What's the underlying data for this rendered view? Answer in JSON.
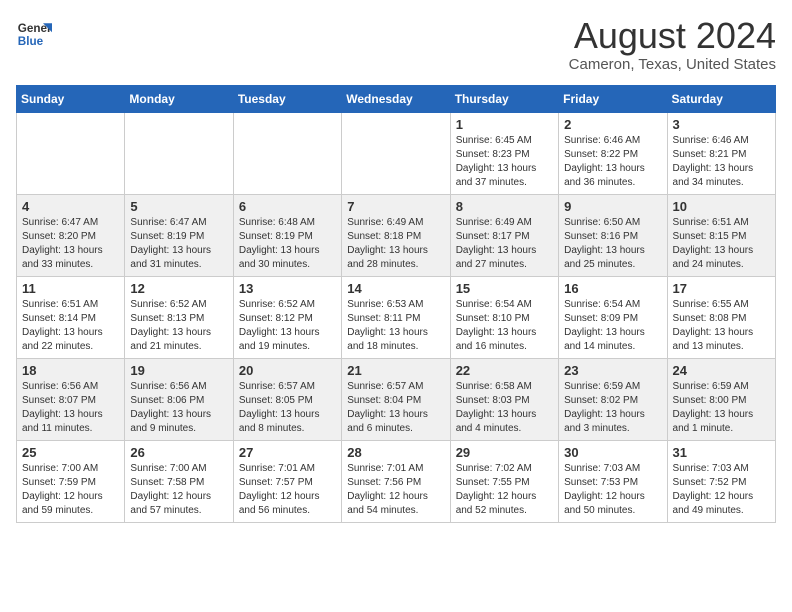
{
  "logo": {
    "line1": "General",
    "line2": "Blue"
  },
  "title": "August 2024",
  "subtitle": "Cameron, Texas, United States",
  "days_of_week": [
    "Sunday",
    "Monday",
    "Tuesday",
    "Wednesday",
    "Thursday",
    "Friday",
    "Saturday"
  ],
  "weeks": [
    [
      {
        "day": "",
        "info": ""
      },
      {
        "day": "",
        "info": ""
      },
      {
        "day": "",
        "info": ""
      },
      {
        "day": "",
        "info": ""
      },
      {
        "day": "1",
        "info": "Sunrise: 6:45 AM\nSunset: 8:23 PM\nDaylight: 13 hours\nand 37 minutes."
      },
      {
        "day": "2",
        "info": "Sunrise: 6:46 AM\nSunset: 8:22 PM\nDaylight: 13 hours\nand 36 minutes."
      },
      {
        "day": "3",
        "info": "Sunrise: 6:46 AM\nSunset: 8:21 PM\nDaylight: 13 hours\nand 34 minutes."
      }
    ],
    [
      {
        "day": "4",
        "info": "Sunrise: 6:47 AM\nSunset: 8:20 PM\nDaylight: 13 hours\nand 33 minutes."
      },
      {
        "day": "5",
        "info": "Sunrise: 6:47 AM\nSunset: 8:19 PM\nDaylight: 13 hours\nand 31 minutes."
      },
      {
        "day": "6",
        "info": "Sunrise: 6:48 AM\nSunset: 8:19 PM\nDaylight: 13 hours\nand 30 minutes."
      },
      {
        "day": "7",
        "info": "Sunrise: 6:49 AM\nSunset: 8:18 PM\nDaylight: 13 hours\nand 28 minutes."
      },
      {
        "day": "8",
        "info": "Sunrise: 6:49 AM\nSunset: 8:17 PM\nDaylight: 13 hours\nand 27 minutes."
      },
      {
        "day": "9",
        "info": "Sunrise: 6:50 AM\nSunset: 8:16 PM\nDaylight: 13 hours\nand 25 minutes."
      },
      {
        "day": "10",
        "info": "Sunrise: 6:51 AM\nSunset: 8:15 PM\nDaylight: 13 hours\nand 24 minutes."
      }
    ],
    [
      {
        "day": "11",
        "info": "Sunrise: 6:51 AM\nSunset: 8:14 PM\nDaylight: 13 hours\nand 22 minutes."
      },
      {
        "day": "12",
        "info": "Sunrise: 6:52 AM\nSunset: 8:13 PM\nDaylight: 13 hours\nand 21 minutes."
      },
      {
        "day": "13",
        "info": "Sunrise: 6:52 AM\nSunset: 8:12 PM\nDaylight: 13 hours\nand 19 minutes."
      },
      {
        "day": "14",
        "info": "Sunrise: 6:53 AM\nSunset: 8:11 PM\nDaylight: 13 hours\nand 18 minutes."
      },
      {
        "day": "15",
        "info": "Sunrise: 6:54 AM\nSunset: 8:10 PM\nDaylight: 13 hours\nand 16 minutes."
      },
      {
        "day": "16",
        "info": "Sunrise: 6:54 AM\nSunset: 8:09 PM\nDaylight: 13 hours\nand 14 minutes."
      },
      {
        "day": "17",
        "info": "Sunrise: 6:55 AM\nSunset: 8:08 PM\nDaylight: 13 hours\nand 13 minutes."
      }
    ],
    [
      {
        "day": "18",
        "info": "Sunrise: 6:56 AM\nSunset: 8:07 PM\nDaylight: 13 hours\nand 11 minutes."
      },
      {
        "day": "19",
        "info": "Sunrise: 6:56 AM\nSunset: 8:06 PM\nDaylight: 13 hours\nand 9 minutes."
      },
      {
        "day": "20",
        "info": "Sunrise: 6:57 AM\nSunset: 8:05 PM\nDaylight: 13 hours\nand 8 minutes."
      },
      {
        "day": "21",
        "info": "Sunrise: 6:57 AM\nSunset: 8:04 PM\nDaylight: 13 hours\nand 6 minutes."
      },
      {
        "day": "22",
        "info": "Sunrise: 6:58 AM\nSunset: 8:03 PM\nDaylight: 13 hours\nand 4 minutes."
      },
      {
        "day": "23",
        "info": "Sunrise: 6:59 AM\nSunset: 8:02 PM\nDaylight: 13 hours\nand 3 minutes."
      },
      {
        "day": "24",
        "info": "Sunrise: 6:59 AM\nSunset: 8:00 PM\nDaylight: 13 hours\nand 1 minute."
      }
    ],
    [
      {
        "day": "25",
        "info": "Sunrise: 7:00 AM\nSunset: 7:59 PM\nDaylight: 12 hours\nand 59 minutes."
      },
      {
        "day": "26",
        "info": "Sunrise: 7:00 AM\nSunset: 7:58 PM\nDaylight: 12 hours\nand 57 minutes."
      },
      {
        "day": "27",
        "info": "Sunrise: 7:01 AM\nSunset: 7:57 PM\nDaylight: 12 hours\nand 56 minutes."
      },
      {
        "day": "28",
        "info": "Sunrise: 7:01 AM\nSunset: 7:56 PM\nDaylight: 12 hours\nand 54 minutes."
      },
      {
        "day": "29",
        "info": "Sunrise: 7:02 AM\nSunset: 7:55 PM\nDaylight: 12 hours\nand 52 minutes."
      },
      {
        "day": "30",
        "info": "Sunrise: 7:03 AM\nSunset: 7:53 PM\nDaylight: 12 hours\nand 50 minutes."
      },
      {
        "day": "31",
        "info": "Sunrise: 7:03 AM\nSunset: 7:52 PM\nDaylight: 12 hours\nand 49 minutes."
      }
    ]
  ]
}
